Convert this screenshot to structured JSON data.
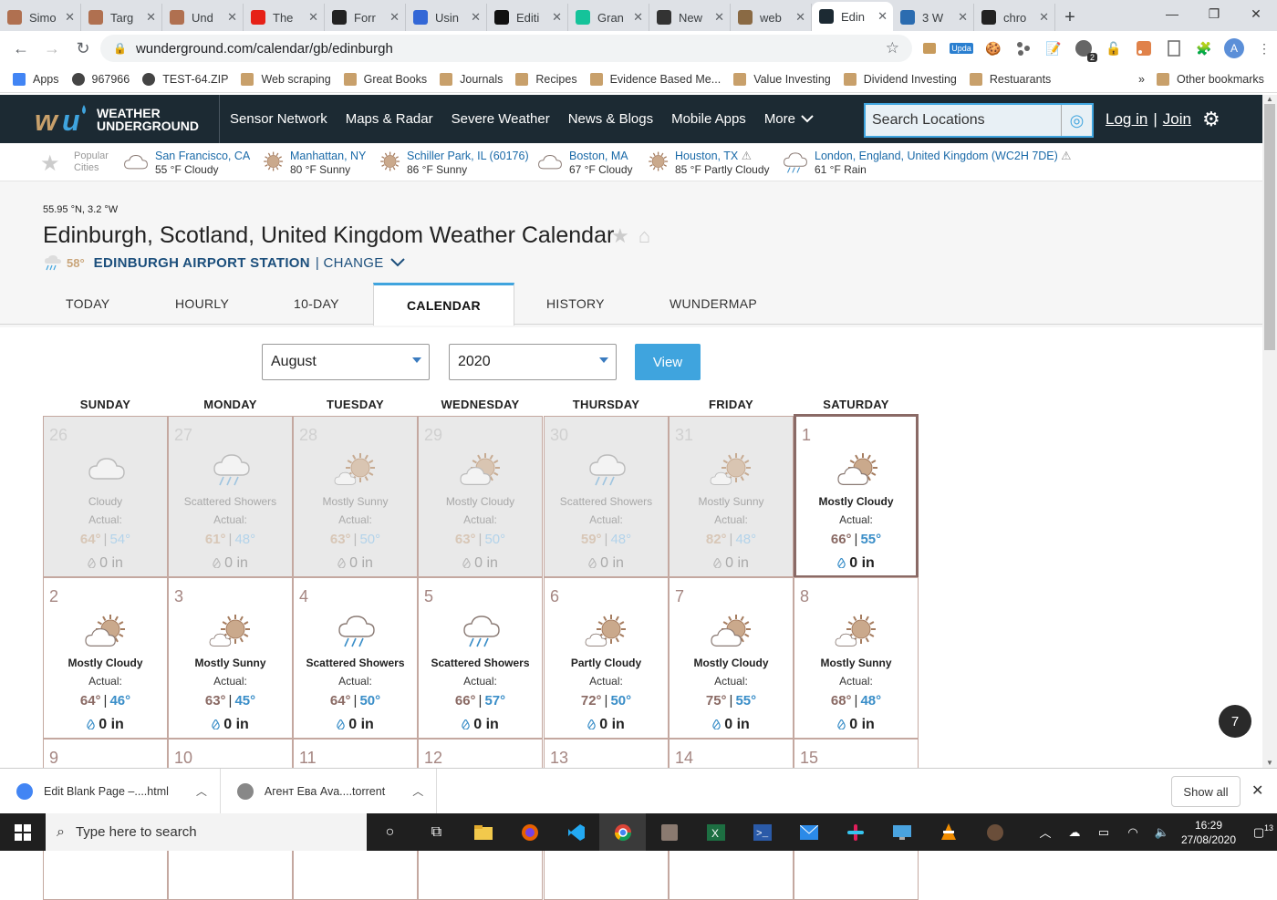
{
  "browser": {
    "tabs": [
      {
        "label": "Simo",
        "icon": "rc-icon",
        "color": "#b07050"
      },
      {
        "label": "Targ",
        "icon": "rc-icon",
        "color": "#b07050"
      },
      {
        "label": "Und",
        "icon": "rc-icon",
        "color": "#b07050"
      },
      {
        "label": "The",
        "icon": "youtube-icon",
        "color": "#e62117"
      },
      {
        "label": "Forr",
        "icon": "github-icon",
        "color": "#222222"
      },
      {
        "label": "Usin",
        "icon": "link-icon",
        "color": "#3367d6"
      },
      {
        "label": "Editi",
        "icon": "medium-icon",
        "color": "#111111"
      },
      {
        "label": "Gran",
        "icon": "grammarly-icon",
        "color": "#15c39a"
      },
      {
        "label": "New",
        "icon": "notion-icon",
        "color": "#333333"
      },
      {
        "label": "web",
        "icon": "scraper-icon",
        "color": "#8a6a44"
      },
      {
        "label": "Edin",
        "icon": "wu-icon",
        "color": "#1c2a33",
        "active": true
      },
      {
        "label": "3 W",
        "icon": "pen-icon",
        "color": "#2b6cb0"
      },
      {
        "label": "chro",
        "icon": "shield-icon",
        "color": "#222222"
      }
    ],
    "new_tab": "+",
    "window_controls": {
      "minimize": "—",
      "maximize": "❐",
      "close": "✕"
    },
    "url": "wunderground.com/calendar/gb/edinburgh",
    "extension_badge_update": "Upda",
    "extension_badge_count": "2",
    "profile_initial": "A",
    "bookmarks": [
      {
        "label": "Apps"
      },
      {
        "label": "967966"
      },
      {
        "label": "TEST-64.ZIP"
      },
      {
        "label": "Web scraping"
      },
      {
        "label": "Great Books"
      },
      {
        "label": "Journals"
      },
      {
        "label": "Recipes"
      },
      {
        "label": "Evidence Based Me..."
      },
      {
        "label": "Value Investing"
      },
      {
        "label": "Dividend Investing"
      },
      {
        "label": "Restuarants"
      }
    ],
    "bookmarks_overflow": "»",
    "other_bookmarks": "Other bookmarks"
  },
  "wu": {
    "logo_line1": "WEATHER",
    "logo_line2": "UNDERGROUND",
    "nav": [
      "Sensor Network",
      "Maps & Radar",
      "Severe Weather",
      "News & Blogs",
      "Mobile Apps",
      "More"
    ],
    "search_placeholder": "Search Locations",
    "login": "Log in",
    "separator": "|",
    "join": "Join",
    "popular_label_1": "Popular",
    "popular_label_2": "Cities",
    "popular_cities": [
      {
        "name": "San Francisco, CA",
        "weather": "55 °F Cloudy",
        "icon": "cloud"
      },
      {
        "name": "Manhattan, NY",
        "weather": "80 °F Sunny",
        "icon": "sun"
      },
      {
        "name": "Schiller Park, IL (60176)",
        "weather": "86 °F Sunny",
        "icon": "sun"
      },
      {
        "name": "Boston, MA",
        "weather": "67 °F Cloudy",
        "icon": "cloud"
      },
      {
        "name": "Houston, TX",
        "weather": "85 °F Partly Cloudy",
        "icon": "sun",
        "alert": true
      },
      {
        "name": "London, England, United Kingdom (WC2H 7DE)",
        "weather": "61 °F Rain",
        "icon": "rain",
        "alert": true
      }
    ]
  },
  "page": {
    "coords": "55.95 °N, 3.2 °W",
    "title": "Edinburgh, Scotland, United Kingdom Weather Calendar",
    "station_temp": "58°",
    "station_name": "EDINBURGH AIRPORT STATION",
    "station_change": "| CHANGE",
    "tabs": [
      "TODAY",
      "HOURLY",
      "10-DAY",
      "CALENDAR",
      "HISTORY",
      "WUNDERMAP"
    ],
    "active_tab": "CALENDAR",
    "month": "August",
    "year": "2020",
    "view_button": "View"
  },
  "calendar": {
    "weekdays": [
      "SUNDAY",
      "MONDAY",
      "TUESDAY",
      "WEDNESDAY",
      "THURSDAY",
      "FRIDAY",
      "SATURDAY"
    ],
    "actual_label": "Actual:",
    "weeks": [
      [
        {
          "day": "26",
          "cond": "Cloudy",
          "icon": "cloud",
          "hi": "64°",
          "lo": "54°",
          "precip": "0 in",
          "past": true
        },
        {
          "day": "27",
          "cond": "Scattered Showers",
          "icon": "showers",
          "hi": "61°",
          "lo": "48°",
          "precip": "0 in",
          "past": true
        },
        {
          "day": "28",
          "cond": "Mostly Sunny",
          "icon": "sun-cloud",
          "hi": "63°",
          "lo": "50°",
          "precip": "0 in",
          "past": true
        },
        {
          "day": "29",
          "cond": "Mostly Cloudy",
          "icon": "cloud-sun",
          "hi": "63°",
          "lo": "50°",
          "precip": "0 in",
          "past": true
        },
        {
          "day": "30",
          "cond": "Scattered Showers",
          "icon": "showers",
          "hi": "59°",
          "lo": "48°",
          "precip": "0 in",
          "past": true
        },
        {
          "day": "31",
          "cond": "Mostly Sunny",
          "icon": "sun-cloud",
          "hi": "82°",
          "lo": "48°",
          "precip": "0 in",
          "past": true
        },
        {
          "day": "1",
          "cond": "Mostly Cloudy",
          "icon": "cloud-sun",
          "hi": "66°",
          "lo": "55°",
          "precip": "0 in",
          "today": true
        }
      ],
      [
        {
          "day": "2",
          "cond": "Mostly Cloudy",
          "icon": "cloud-sun",
          "hi": "64°",
          "lo": "46°",
          "precip": "0 in"
        },
        {
          "day": "3",
          "cond": "Mostly Sunny",
          "icon": "sun-cloud",
          "hi": "63°",
          "lo": "45°",
          "precip": "0 in"
        },
        {
          "day": "4",
          "cond": "Scattered Showers",
          "icon": "showers",
          "hi": "64°",
          "lo": "50°",
          "precip": "0 in"
        },
        {
          "day": "5",
          "cond": "Scattered Showers",
          "icon": "showers",
          "hi": "66°",
          "lo": "57°",
          "precip": "0 in"
        },
        {
          "day": "6",
          "cond": "Partly Cloudy",
          "icon": "sun-cloud",
          "hi": "72°",
          "lo": "50°",
          "precip": "0 in"
        },
        {
          "day": "7",
          "cond": "Mostly Cloudy",
          "icon": "cloud-sun",
          "hi": "75°",
          "lo": "55°",
          "precip": "0 in"
        },
        {
          "day": "8",
          "cond": "Mostly Sunny",
          "icon": "sun-cloud",
          "hi": "68°",
          "lo": "48°",
          "precip": "0 in"
        }
      ],
      [
        {
          "day": "9"
        },
        {
          "day": "10"
        },
        {
          "day": "11"
        },
        {
          "day": "12"
        },
        {
          "day": "13"
        },
        {
          "day": "14"
        },
        {
          "day": "15"
        }
      ]
    ],
    "floating_badge": "7"
  },
  "downloads": {
    "items": [
      {
        "label": "Edit Blank Page –....html",
        "color": "#4285f4"
      },
      {
        "label": "Агент Ева Ava....torrent",
        "color": "#888888"
      }
    ],
    "show_all": "Show all",
    "close": "✕"
  },
  "taskbar": {
    "search_placeholder": "Type here to search",
    "time": "16:29",
    "date": "27/08/2020",
    "notification_count": "13"
  }
}
